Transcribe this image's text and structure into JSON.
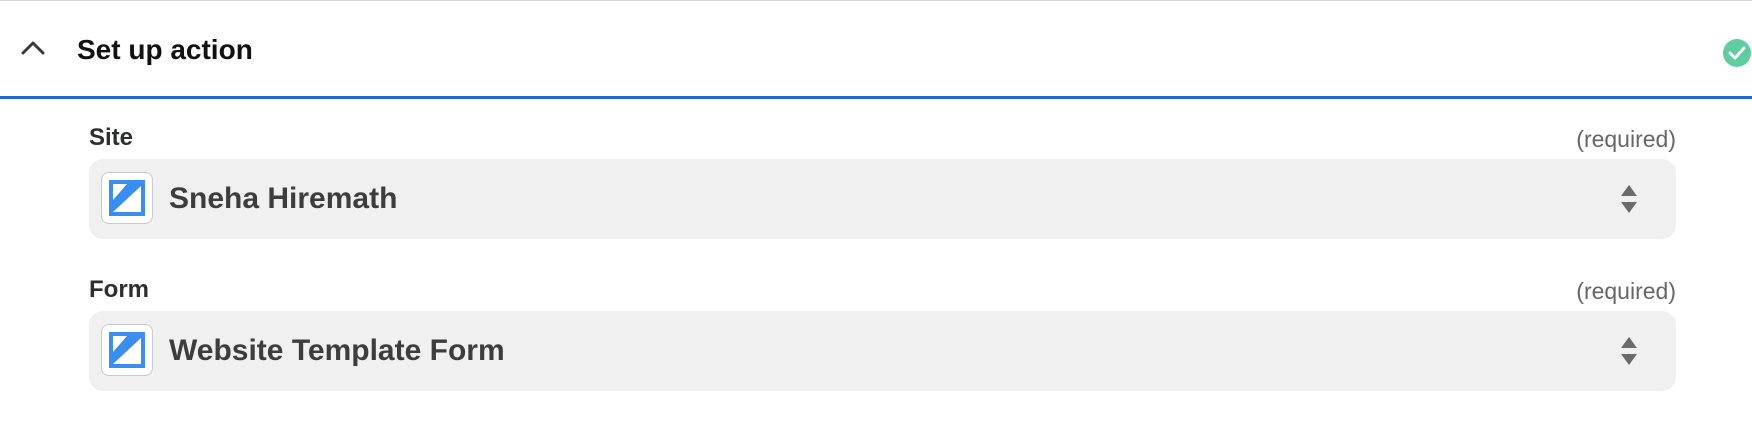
{
  "header": {
    "title": "Set up action",
    "status_color": "#5fcca2",
    "accent_color": "#1e67d8"
  },
  "fields": [
    {
      "label": "Site",
      "required": "(required)",
      "value": "Sneha Hiremath",
      "icon": "kustomer-app-icon"
    },
    {
      "label": "Form",
      "required": "(required)",
      "value": "Website Template Form",
      "icon": "kustomer-app-icon"
    }
  ]
}
